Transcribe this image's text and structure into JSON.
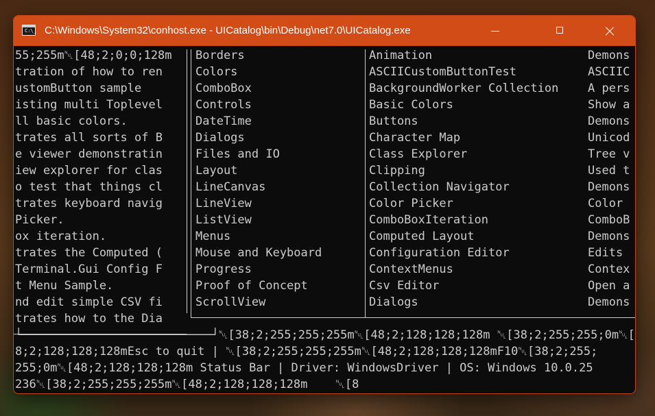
{
  "window": {
    "title": "C:\\Windows\\System32\\conhost.exe - UICatalog\\bin\\Debug\\net7.0\\UICatalog.exe",
    "icon": "console-icon",
    "icon_text": "C:\\_"
  },
  "left_panel_lines": [
    "55;255m␀[48;2;0;0;128m",
    "tration of how to ren",
    "ustomButton sample",
    "isting multi Toplevel",
    "ll basic colors.",
    "trates all sorts of B",
    "e viewer demonstratin",
    "iew explorer for clas",
    "o test that things cl",
    "trates keyboard navig",
    "Picker.",
    "ox iteration.",
    "trates the Computed (",
    "Terminal.Gui Config F",
    "t Menu Sample.",
    "nd edit simple CSV fi",
    "trates how to the Dia"
  ],
  "categories": [
    "Borders",
    "Colors",
    "ComboBox",
    "Controls",
    "DateTime",
    "Dialogs",
    "Files and IO",
    "Layout",
    "LineCanvas",
    "LineView",
    "ListView",
    "Menus",
    "Mouse and Keyboard",
    "Progress",
    "Proof of Concept",
    "ScrollView"
  ],
  "scenarios": [
    "Animation",
    "ASCIICustomButtonTest",
    "BackgroundWorker Collection",
    "Basic Colors",
    "Buttons",
    "Character Map",
    "Class Explorer",
    "Clipping",
    "Collection Navigator",
    "Color Picker",
    "ComboBoxIteration",
    "Computed Layout",
    "Configuration Editor",
    "ContextMenus",
    "Csv Editor",
    "Dialogs"
  ],
  "descriptions": [
    "Demons",
    "ASCIIC",
    "A pers",
    "Show a",
    "Demons",
    "Unicod",
    "Tree v",
    "Used t",
    "Demons",
    "Color ",
    "ComboB",
    "Demons",
    "Edits ",
    "Contex",
    "Open a",
    "Demons"
  ],
  "status_lines": [
    "└───────────────────────────┘␀[38;2;255;255;255m␀[48;2;128;128;128m ␀[38;2;255;255;0m␀[4",
    "8;2;128;128;128mEsc to quit | ␀[38;2;255;255;255m␀[48;2;128;128;128mF10␀[38;2;255;",
    "255;0m␀[48;2;128;128;128m Status Bar | Driver: WindowsDriver | OS: Windows 10.0.25",
    "236␀[38;2;255;255;255m␀[48;2;128;128;128m    ␀[8"
  ]
}
